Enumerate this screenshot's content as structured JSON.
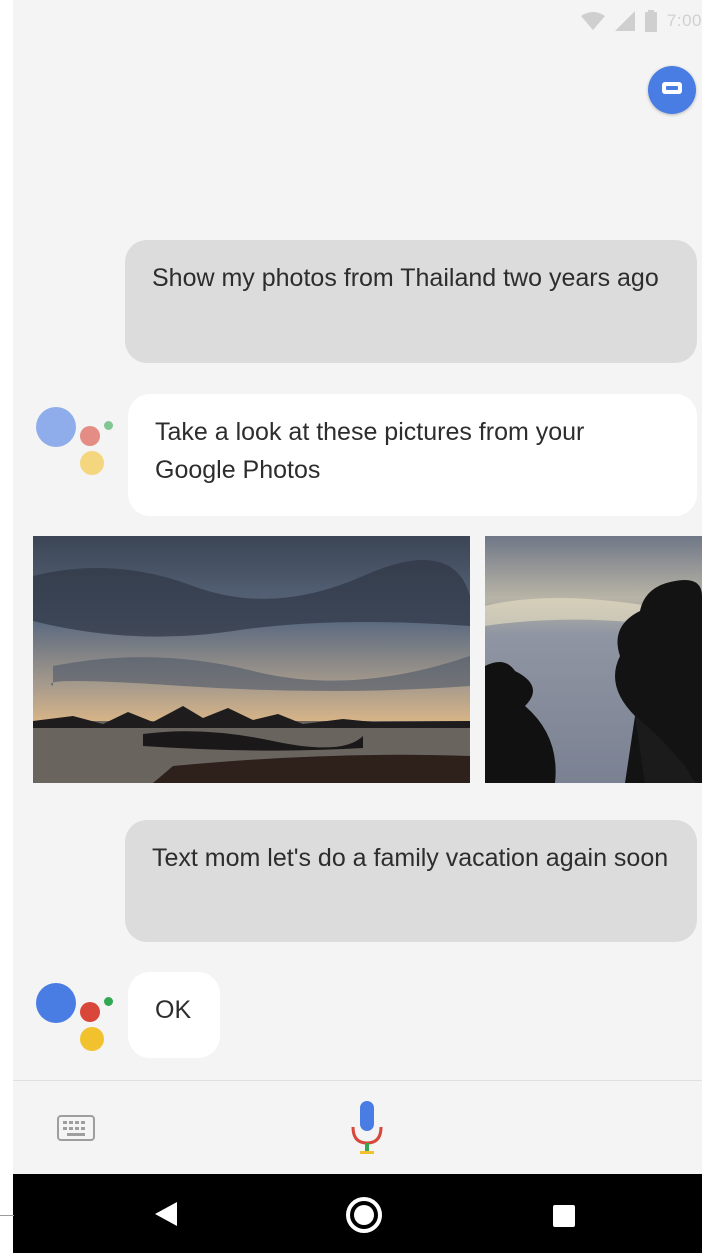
{
  "status_bar": {
    "time": "7:00",
    "icons": [
      "wifi-icon",
      "cellular-signal-icon",
      "battery-icon"
    ]
  },
  "header": {
    "action_icon": "keyboard-chat-icon",
    "action_color": "#4a7de3"
  },
  "conversation": [
    {
      "role": "user",
      "text": "Show my photos from Thailand two years ago"
    },
    {
      "role": "assistant",
      "text": "Take a look at these pictures from your Google Photos"
    },
    {
      "role": "user",
      "text": "Text mom let's do a family vacation again soon"
    },
    {
      "role": "assistant",
      "text": "OK"
    }
  ],
  "photos": [
    {
      "name": "sunset-over-bay-photo"
    },
    {
      "name": "tree-silhouette-photo"
    }
  ],
  "assistant_logo": {
    "colors": {
      "blue": "#4a7de3",
      "red": "#d9473b",
      "yellow": "#f2c12e",
      "green": "#33a853"
    }
  },
  "input_bar": {
    "keyboard_icon": "keyboard-icon",
    "mic_icon": "mic-icon"
  },
  "nav_bar": {
    "buttons": [
      "back-icon",
      "home-icon",
      "recents-icon"
    ]
  }
}
